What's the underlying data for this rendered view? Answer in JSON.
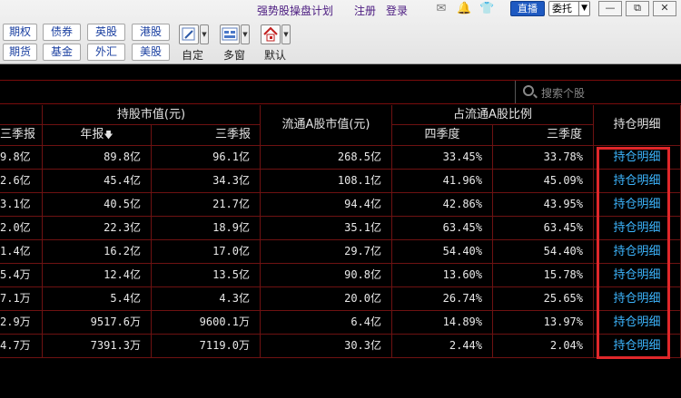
{
  "topbar": {
    "links": [
      "强势股操盘计划",
      "注册",
      "登录"
    ],
    "live_label": "直播",
    "entrust_label": "委托",
    "window_buttons": [
      "—",
      "⧉",
      "✕"
    ]
  },
  "market_buttons": [
    "期权",
    "债券",
    "英股",
    "港股",
    "期货",
    "基金",
    "外汇",
    "美股"
  ],
  "tools": [
    {
      "label": "自定",
      "icon": "pencil-icon"
    },
    {
      "label": "多窗",
      "icon": "multi-window-icon"
    },
    {
      "label": "默认",
      "icon": "home-icon"
    }
  ],
  "search": {
    "placeholder": "搜索个股"
  },
  "table": {
    "group_headers": {
      "market_value": "持股市值(元)",
      "float_value": "流通A股市值(元)",
      "float_ratio": "占流通A股比例",
      "detail": "持仓明细"
    },
    "sub_headers": [
      "三季报",
      "年报",
      "三季报",
      "四季度",
      "三季度"
    ],
    "sort_icon": "down-arrow-icon",
    "rows": [
      [
        "9.8亿",
        "89.8亿",
        "96.1亿",
        "268.5亿",
        "33.45%",
        "33.78%",
        "持仓明细"
      ],
      [
        "2.6亿",
        "45.4亿",
        "34.3亿",
        "108.1亿",
        "41.96%",
        "45.09%",
        "持仓明细"
      ],
      [
        "3.1亿",
        "40.5亿",
        "21.7亿",
        "94.4亿",
        "42.86%",
        "43.95%",
        "持仓明细"
      ],
      [
        "2.0亿",
        "22.3亿",
        "18.9亿",
        "35.1亿",
        "63.45%",
        "63.45%",
        "持仓明细"
      ],
      [
        "1.4亿",
        "16.2亿",
        "17.0亿",
        "29.7亿",
        "54.40%",
        "54.40%",
        "持仓明细"
      ],
      [
        "5.4万",
        "12.4亿",
        "13.5亿",
        "90.8亿",
        "13.60%",
        "15.78%",
        "持仓明细"
      ],
      [
        "7.1万",
        "5.4亿",
        "4.3亿",
        "20.0亿",
        "26.74%",
        "25.65%",
        "持仓明细"
      ],
      [
        "2.9万",
        "9517.6万",
        "9600.1万",
        "6.4亿",
        "14.89%",
        "13.97%",
        "持仓明细"
      ],
      [
        "4.7万",
        "7391.3万",
        "7119.0万",
        "30.3亿",
        "2.44%",
        "2.04%",
        "持仓明细"
      ]
    ]
  },
  "colors": {
    "grid": "#6e1212",
    "link": "#3db6ff",
    "highlight": "#e0272a",
    "text": "#e8e8e8"
  }
}
